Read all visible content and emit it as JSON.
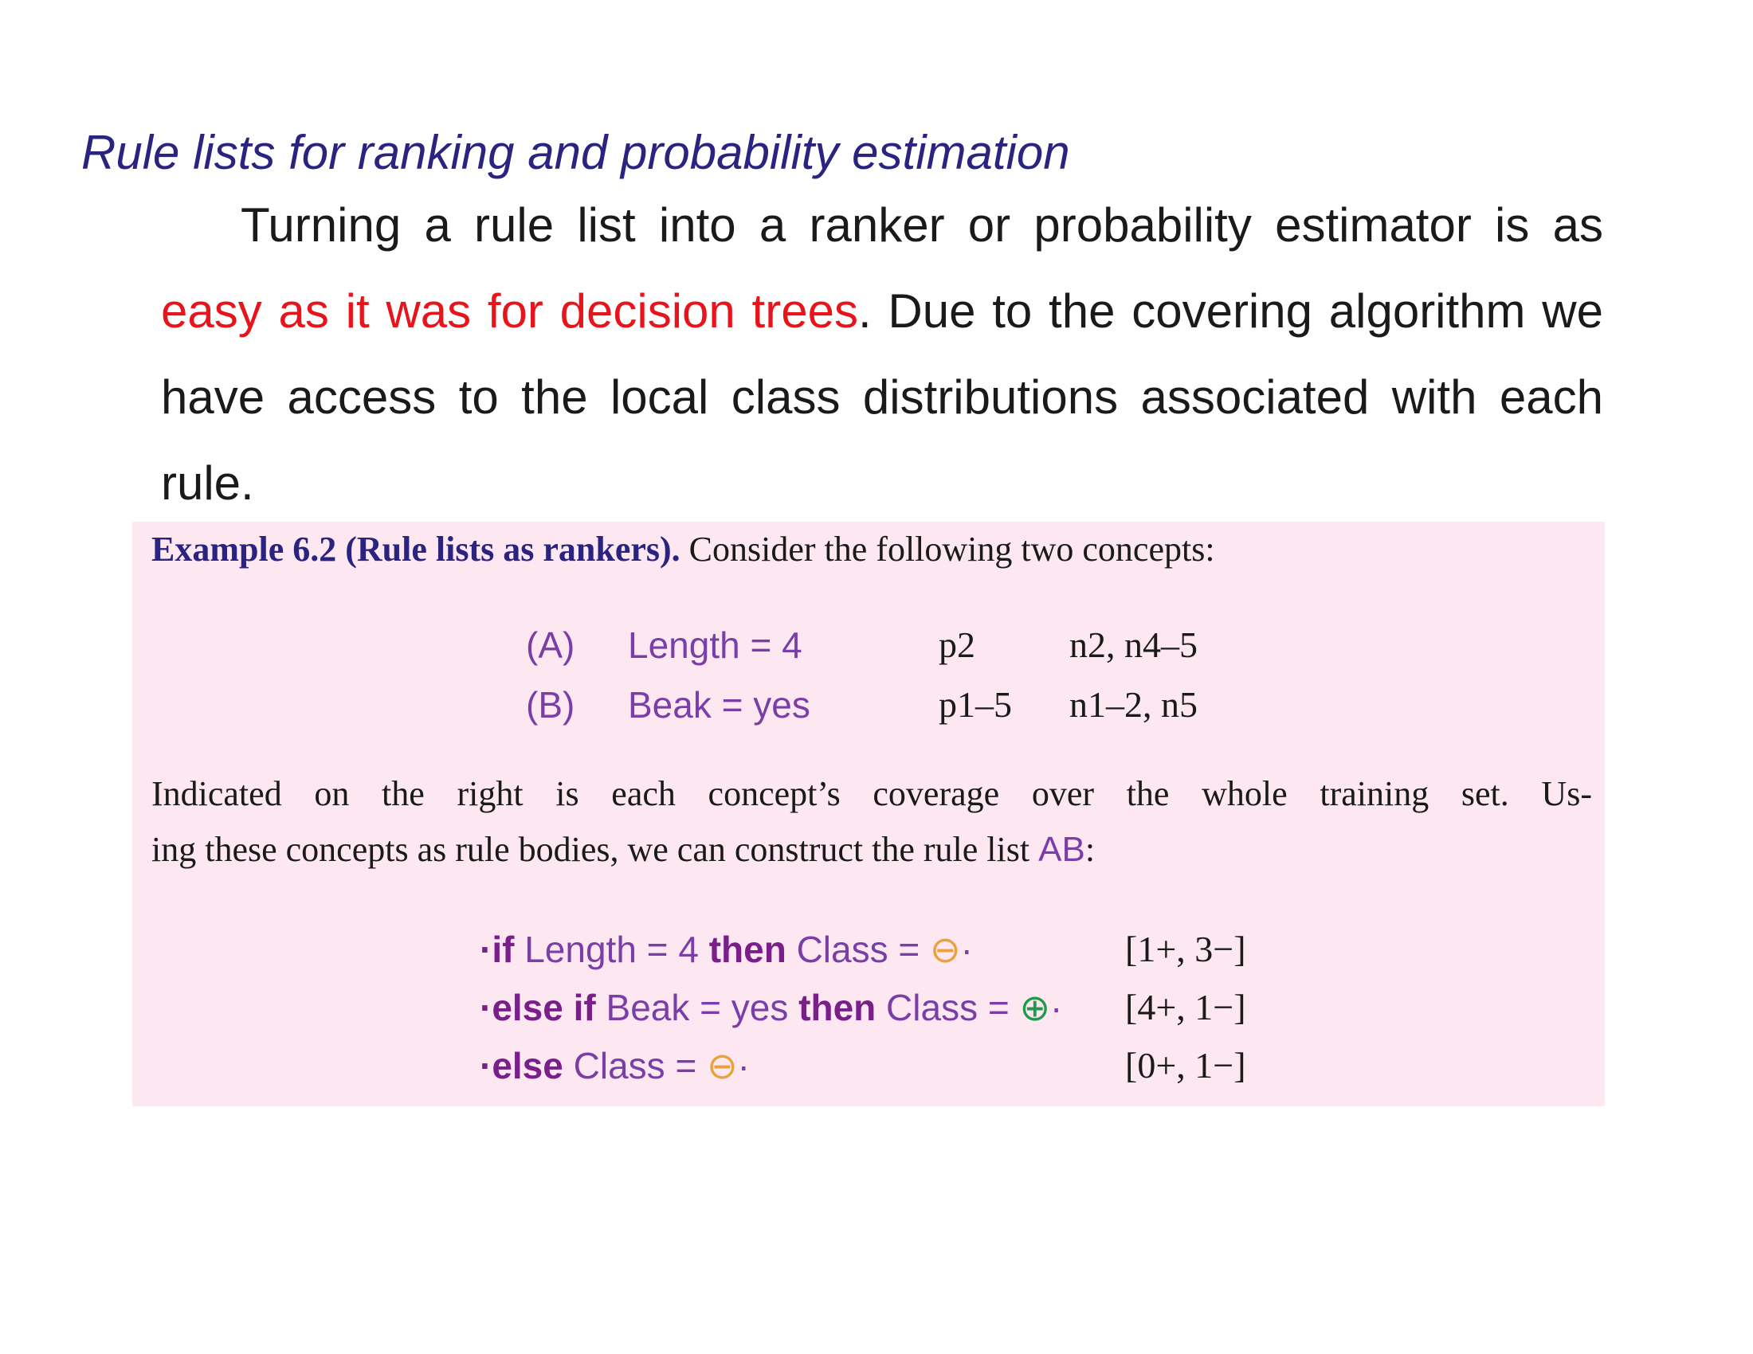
{
  "slide": {
    "title": "Rule lists for ranking and probability estimation"
  },
  "paragraph": {
    "line1": "Turning a rule list into a ranker or probability estimator is as",
    "line2_red": "easy as it was for decision trees",
    "line2_rest": ". Due to the covering algorithm we",
    "line3": "have access to the local class distributions associated with each",
    "line4": "rule."
  },
  "example": {
    "title": "Example 6.2 (Rule lists as rankers).",
    "intro": "Consider the following two concepts:",
    "concepts": [
      {
        "label": "(A)",
        "condition": "Length = 4",
        "positives": "p2",
        "negatives": "n2, n4–5"
      },
      {
        "label": "(B)",
        "condition": "Beak = yes",
        "positives": "p1–5",
        "negatives": "n1–2, n5"
      }
    ],
    "body_line1": "Indicated on the right is each concept’s coverage over the whole training set. Us-",
    "body_line2": "ing these concepts as rule bodies, we can construct the rule list",
    "rule_list_name": "AB",
    "body_line2_end": ":",
    "rules": [
      {
        "prefix": "·if",
        "condition": " Length = 4 ",
        "then": "then",
        "conclusion": " Class = ",
        "class_symbol": "⊖",
        "suffix": "·",
        "coverage": "[1+, 3−]"
      },
      {
        "prefix": "·else if",
        "condition": " Beak = yes ",
        "then": "then",
        "conclusion": " Class = ",
        "class_symbol": "⊕",
        "suffix": "·",
        "coverage": "[4+, 1−]"
      },
      {
        "prefix": "·else",
        "condition": "",
        "then": "",
        "conclusion": " Class = ",
        "class_symbol": "⊖",
        "suffix": "·",
        "coverage": "[0+, 1−]"
      }
    ]
  },
  "colors": {
    "title": "#2a2380",
    "highlight_red": "#e8141c",
    "box_background": "#fde8f1",
    "negative_class": "#e8a13c",
    "positive_class": "#1f9a4a",
    "math_purple": "#7a3ea8"
  }
}
